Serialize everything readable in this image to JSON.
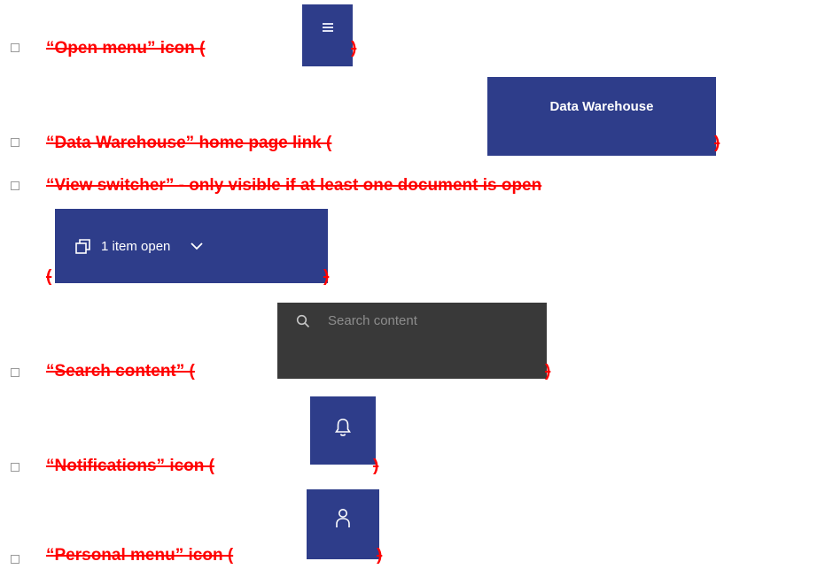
{
  "items": [
    {
      "label": "“Open menu” icon (",
      "close": ")"
    },
    {
      "label": "“Data Warehouse” home page link (",
      "close": ")"
    },
    {
      "label": "“View switcher” - only visible if at least one document is open",
      "open": "(",
      "close": ")"
    },
    {
      "label": "“Search content” (",
      "close": ")"
    },
    {
      "label": "“Notifications” icon (",
      "close": ")"
    },
    {
      "label": "“Personal menu” icon (",
      "close": ")"
    }
  ],
  "screenshots": {
    "data_warehouse": "Data Warehouse",
    "view_switcher": "1 item open",
    "search_placeholder": "Search content"
  },
  "colors": {
    "annotation_text": "#ff0000",
    "header_blue": "#2e3d8a",
    "search_bg": "#393939"
  },
  "icons": [
    "hamburger-icon",
    "window-switcher-icon",
    "chevron-down-icon",
    "search-icon",
    "bell-icon",
    "user-icon"
  ]
}
